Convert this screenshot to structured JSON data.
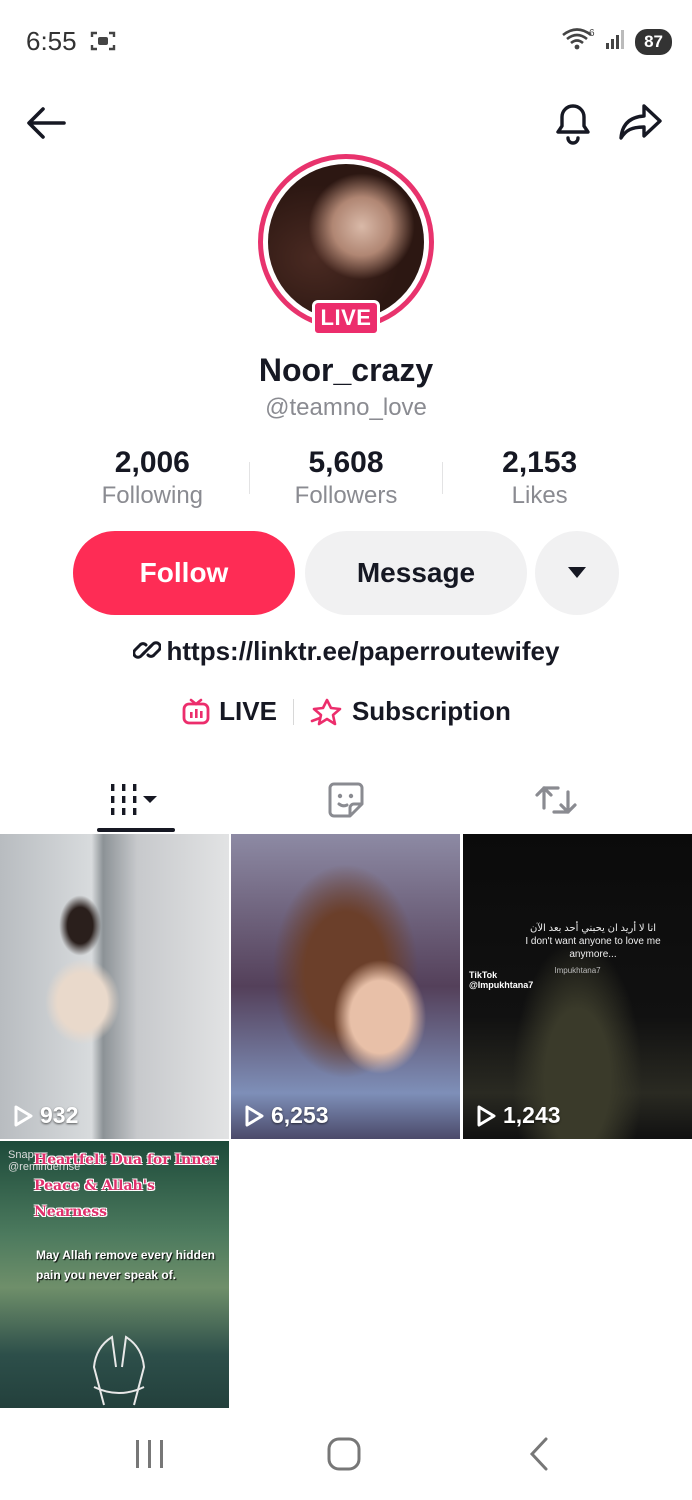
{
  "status_bar": {
    "time": "6:55",
    "battery": "87",
    "wifi_badge": "6"
  },
  "profile": {
    "live_badge": "LIVE",
    "display_name": "Noor_crazy",
    "username": "@teamno_love",
    "stats": [
      {
        "value": "2,006",
        "label": "Following"
      },
      {
        "value": "5,608",
        "label": "Followers"
      },
      {
        "value": "2,153",
        "label": "Likes"
      }
    ],
    "link": "https://linktr.ee/paperroutewifey"
  },
  "actions": {
    "follow": "Follow",
    "message": "Message"
  },
  "features": {
    "live": "LIVE",
    "subscription": "Subscription"
  },
  "colors": {
    "accent": "#fe2c55",
    "live_pink": "#ec2d6c"
  },
  "videos": [
    {
      "views": "932"
    },
    {
      "views": "6,253"
    },
    {
      "views": "1,243",
      "text_arabic": "انا لا أريد ان يحبني أحد بعد الآن",
      "text_en": "I don't want anyone to love me anymore...",
      "caption": "Impukhtana7",
      "tiktok": "TikTok",
      "tiktok_user": "@Impukhtana7"
    },
    {
      "watermark": "Snap",
      "watermark_user": "@reminderrise",
      "title": "Heartfelt Dua for Inner Peace & Allah's Nearness",
      "body": "May Allah remove every hidden pain you never speak of."
    }
  ]
}
